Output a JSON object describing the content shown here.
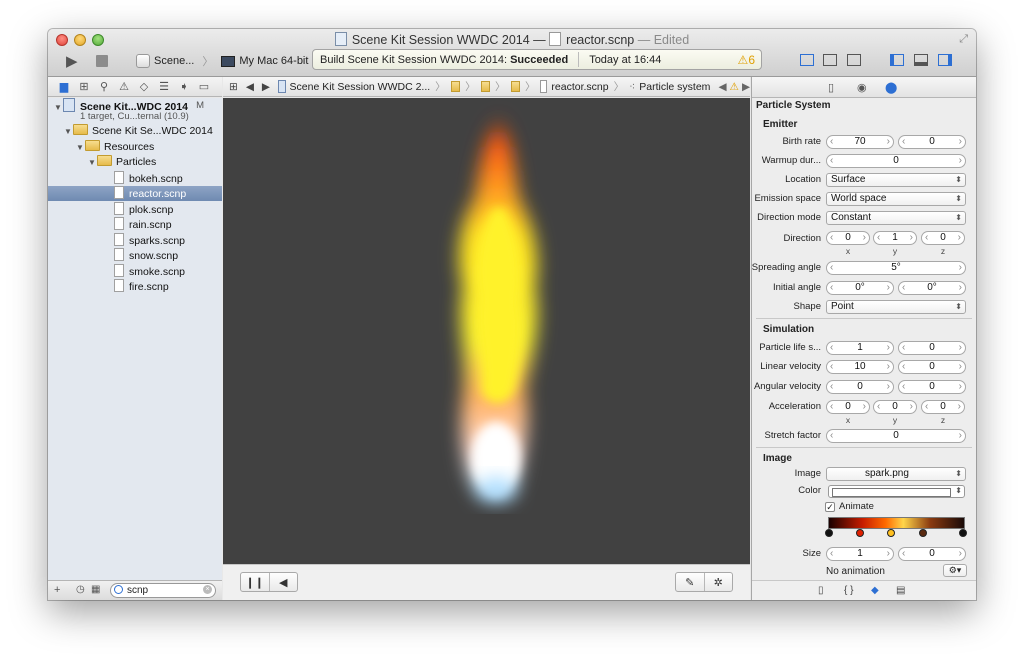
{
  "window": {
    "project_name": "Scene Kit Session WWDC 2014",
    "separator": "—",
    "file_name": "reactor.scnp",
    "edited_label": "— Edited"
  },
  "toolbar": {
    "scheme_name": "Scene...",
    "destination": "My Mac 64-bit",
    "activity_text": "Build Scene Kit Session WWDC 2014:",
    "activity_status": "Succeeded",
    "activity_time": "Today at 16:44",
    "warning_count": "6"
  },
  "navigator": {
    "project": {
      "name": "Scene Kit...WDC 2014",
      "subtitle": "1 target, Cu...ternal (10.9)",
      "badge": "M"
    },
    "group": "Scene Kit Se...WDC 2014",
    "resources": "Resources",
    "particles": "Particles",
    "files": [
      "bokeh.scnp",
      "reactor.scnp",
      "plok.scnp",
      "rain.scnp",
      "sparks.scnp",
      "snow.scnp",
      "smoke.scnp",
      "fire.scnp"
    ],
    "selected_file": "reactor.scnp",
    "filter_value": "scnp"
  },
  "jumpbar": {
    "project": "Scene Kit Session WWDC 2...",
    "file": "reactor.scnp",
    "item": "Particle system"
  },
  "inspector": {
    "title": "Particle System",
    "emitter": {
      "heading": "Emitter",
      "birth_rate_label": "Birth rate",
      "birth_rate": "70",
      "birth_rate_var": "0",
      "warmup_label": "Warmup dur...",
      "warmup": "0",
      "location_label": "Location",
      "location": "Surface",
      "emission_space_label": "Emission space",
      "emission_space": "World space",
      "direction_mode_label": "Direction mode",
      "direction_mode": "Constant",
      "direction_label": "Direction",
      "direction": {
        "x": "0",
        "y": "1",
        "z": "0"
      },
      "spreading_label": "Spreading angle",
      "spreading": "5°",
      "initial_angle_label": "Initial angle",
      "initial_angle": "0°",
      "initial_angle_var": "0°",
      "shape_label": "Shape",
      "shape": "Point"
    },
    "simulation": {
      "heading": "Simulation",
      "life_label": "Particle life s...",
      "life": "1",
      "life_var": "0",
      "linear_label": "Linear velocity",
      "linear": "10",
      "linear_var": "0",
      "angular_label": "Angular velocity",
      "angular": "0",
      "angular_var": "0",
      "accel_label": "Acceleration",
      "accel": {
        "x": "0",
        "y": "0",
        "z": "0"
      },
      "stretch_label": "Stretch factor",
      "stretch": "0"
    },
    "image": {
      "heading": "Image",
      "image_label": "Image",
      "image": "spark.png",
      "color_label": "Color",
      "animate_label": "Animate",
      "animate_checked": "✓",
      "size_label": "Size",
      "size": "1",
      "size_var": "0",
      "no_animation": "No animation"
    },
    "axis_labels": {
      "x": "x",
      "y": "y",
      "z": "z"
    }
  },
  "colors": {
    "viewport_bg": "#414141",
    "selection": "#7a92b8",
    "accent": "#2d6fd3",
    "warning": "#e0a000"
  }
}
